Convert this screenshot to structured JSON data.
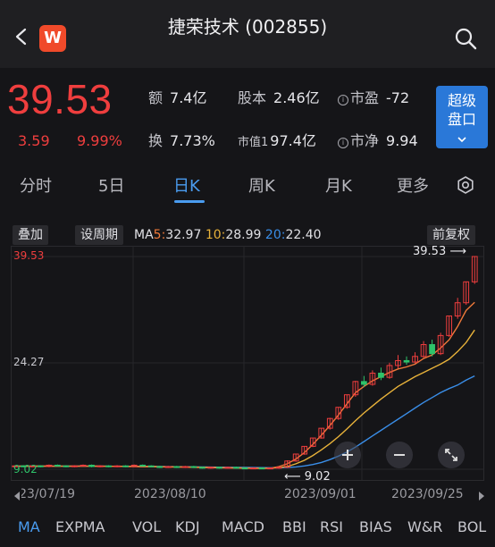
{
  "header": {
    "title": "捷荣技术 (002855)",
    "logo_letter": "W"
  },
  "quote": {
    "price": "39.53",
    "change": "3.59",
    "change_pct": "9.99%",
    "stats": [
      {
        "label": "额",
        "value": "7.4亿"
      },
      {
        "label": "股本",
        "value": "2.46亿"
      },
      {
        "label": "市盈",
        "value": "-72"
      },
      {
        "label": "换",
        "value": "7.73%"
      },
      {
        "label": "市值1",
        "value": "97.4亿"
      },
      {
        "label": "市净",
        "value": "9.94"
      }
    ],
    "super_button": {
      "line1": "超级",
      "line2": "盘口"
    }
  },
  "tabs": [
    "分时",
    "5日",
    "日K",
    "周K",
    "月K",
    "更多"
  ],
  "active_tab": "日K",
  "chart_toolbar": {
    "overlay": "叠加",
    "set_period": "设周期",
    "ma_prefix": "MA",
    "ma5_label": "5:",
    "ma5": "32.97",
    "ma10_label": "10:",
    "ma10": "28.99",
    "ma20_label": "20:",
    "ma20": "22.40",
    "adjust": "前复权"
  },
  "colors": {
    "up": "#ef3e3e",
    "down": "#2ec36a",
    "ma5": "#f07a3a",
    "ma10": "#e8b23a",
    "ma20": "#3a8ee8",
    "accent": "#4a9cf0"
  },
  "chart_data": {
    "type": "candlestick",
    "y_labels": [
      "39.53",
      "24.27",
      "9.02"
    ],
    "high_marker": "39.53",
    "low_marker": "9.02",
    "x_labels": [
      "2023/07/19",
      "2023/08/10",
      "2023/09/01",
      "2023/09/25"
    ],
    "ylim": [
      9.02,
      39.53
    ],
    "candles": [
      [
        9.4,
        9.5,
        9.3,
        9.6
      ],
      [
        9.5,
        9.4,
        9.3,
        9.6
      ],
      [
        9.4,
        9.5,
        9.3,
        9.6
      ],
      [
        9.5,
        9.4,
        9.3,
        9.6
      ],
      [
        9.4,
        9.6,
        9.3,
        9.7
      ],
      [
        9.6,
        9.5,
        9.4,
        9.7
      ],
      [
        9.5,
        9.4,
        9.3,
        9.6
      ],
      [
        9.4,
        9.5,
        9.3,
        9.6
      ],
      [
        9.5,
        9.6,
        9.4,
        9.7
      ],
      [
        9.6,
        9.4,
        9.3,
        9.7
      ],
      [
        9.4,
        9.5,
        9.3,
        9.6
      ],
      [
        9.5,
        9.4,
        9.3,
        9.6
      ],
      [
        9.4,
        9.5,
        9.3,
        9.6
      ],
      [
        9.5,
        9.4,
        9.3,
        9.6
      ],
      [
        9.4,
        9.6,
        9.3,
        9.7
      ],
      [
        9.6,
        9.5,
        9.4,
        9.7
      ],
      [
        9.5,
        9.4,
        9.3,
        9.6
      ],
      [
        9.4,
        9.3,
        9.2,
        9.5
      ],
      [
        9.3,
        9.4,
        9.2,
        9.5
      ],
      [
        9.4,
        9.3,
        9.2,
        9.5
      ],
      [
        9.3,
        9.4,
        9.2,
        9.5
      ],
      [
        9.4,
        9.3,
        9.2,
        9.5
      ],
      [
        9.3,
        9.2,
        9.1,
        9.4
      ],
      [
        9.2,
        9.3,
        9.1,
        9.4
      ],
      [
        9.3,
        9.2,
        9.1,
        9.4
      ],
      [
        9.2,
        9.3,
        9.1,
        9.4
      ],
      [
        9.3,
        9.2,
        9.1,
        9.4
      ],
      [
        9.2,
        9.1,
        9.05,
        9.3
      ],
      [
        9.1,
        9.2,
        9.05,
        9.3
      ],
      [
        9.2,
        9.1,
        9.02,
        9.25
      ],
      [
        9.1,
        9.2,
        9.05,
        9.3
      ],
      [
        9.2,
        9.3,
        9.1,
        9.4
      ],
      [
        9.3,
        10.2,
        9.2,
        10.3
      ],
      [
        10.2,
        11.2,
        10.1,
        11.2
      ],
      [
        11.2,
        12.3,
        11.1,
        12.3
      ],
      [
        12.3,
        13.5,
        12.2,
        13.5
      ],
      [
        13.5,
        14.9,
        13.4,
        14.9
      ],
      [
        14.9,
        16.3,
        14.7,
        16.4
      ],
      [
        16.3,
        17.9,
        16.1,
        17.9
      ],
      [
        17.9,
        19.7,
        17.7,
        19.7
      ],
      [
        19.7,
        21.6,
        19.4,
        21.7
      ],
      [
        21.6,
        21.2,
        20.8,
        22.4
      ],
      [
        21.2,
        22.8,
        21.0,
        23.2
      ],
      [
        22.8,
        22.2,
        21.8,
        23.6
      ],
      [
        22.2,
        23.9,
        22.0,
        24.3
      ],
      [
        23.9,
        24.6,
        23.5,
        25.4
      ],
      [
        24.6,
        24.4,
        24.0,
        25.2
      ],
      [
        24.4,
        25.2,
        24.2,
        25.8
      ],
      [
        25.2,
        26.9,
        25.0,
        27.4
      ],
      [
        26.9,
        25.6,
        25.2,
        27.6
      ],
      [
        25.6,
        28.2,
        25.4,
        28.6
      ],
      [
        28.2,
        31.0,
        28.0,
        31.0
      ],
      [
        31.0,
        32.9,
        30.6,
        33.6
      ],
      [
        32.9,
        35.9,
        32.6,
        35.9
      ],
      [
        35.9,
        39.53,
        35.6,
        39.53
      ]
    ],
    "ma5": [
      9.45,
      9.45,
      9.46,
      9.47,
      9.46,
      9.45,
      9.45,
      9.45,
      9.46,
      9.46,
      9.45,
      9.44,
      9.43,
      9.42,
      9.41,
      9.4,
      9.38,
      9.36,
      9.34,
      9.33,
      9.31,
      9.29,
      9.27,
      9.25,
      9.23,
      9.21,
      9.19,
      9.17,
      9.16,
      9.15,
      9.16,
      9.4,
      9.8,
      10.5,
      11.4,
      12.6,
      13.9,
      15.3,
      16.8,
      18.4,
      20.0,
      20.9,
      21.7,
      22.3,
      22.9,
      23.4,
      23.7,
      24.1,
      24.9,
      25.4,
      26.4,
      27.6,
      29.5,
      31.8,
      32.97
    ],
    "ma10": [
      9.45,
      9.45,
      9.45,
      9.45,
      9.46,
      9.46,
      9.46,
      9.45,
      9.45,
      9.45,
      9.45,
      9.44,
      9.44,
      9.43,
      9.42,
      9.41,
      9.4,
      9.39,
      9.37,
      9.36,
      9.34,
      9.32,
      9.3,
      9.28,
      9.26,
      9.24,
      9.22,
      9.2,
      9.19,
      9.18,
      9.18,
      9.25,
      9.4,
      9.8,
      10.3,
      11.0,
      11.8,
      12.7,
      13.7,
      14.8,
      16.0,
      17.1,
      18.1,
      19.1,
      20.0,
      20.9,
      21.6,
      22.3,
      22.9,
      23.5,
      24.1,
      24.8,
      25.9,
      27.2,
      28.99
    ],
    "ma20": [
      9.45,
      9.45,
      9.45,
      9.45,
      9.45,
      9.45,
      9.45,
      9.45,
      9.45,
      9.45,
      9.45,
      9.45,
      9.44,
      9.44,
      9.43,
      9.42,
      9.41,
      9.4,
      9.39,
      9.38,
      9.37,
      9.36,
      9.35,
      9.33,
      9.31,
      9.3,
      9.28,
      9.27,
      9.26,
      9.25,
      9.24,
      9.25,
      9.27,
      9.35,
      9.5,
      9.7,
      10.0,
      10.4,
      10.9,
      11.5,
      12.2,
      13.0,
      13.8,
      14.6,
      15.4,
      16.2,
      17.0,
      17.8,
      18.6,
      19.3,
      20.0,
      20.6,
      21.1,
      21.8,
      22.4
    ]
  },
  "indicators": [
    "MA",
    "EXPMA",
    "VOL",
    "KDJ",
    "MACD",
    "BBI",
    "RSI",
    "BIAS",
    "W&R",
    "BOL"
  ],
  "active_indicator": "MA"
}
